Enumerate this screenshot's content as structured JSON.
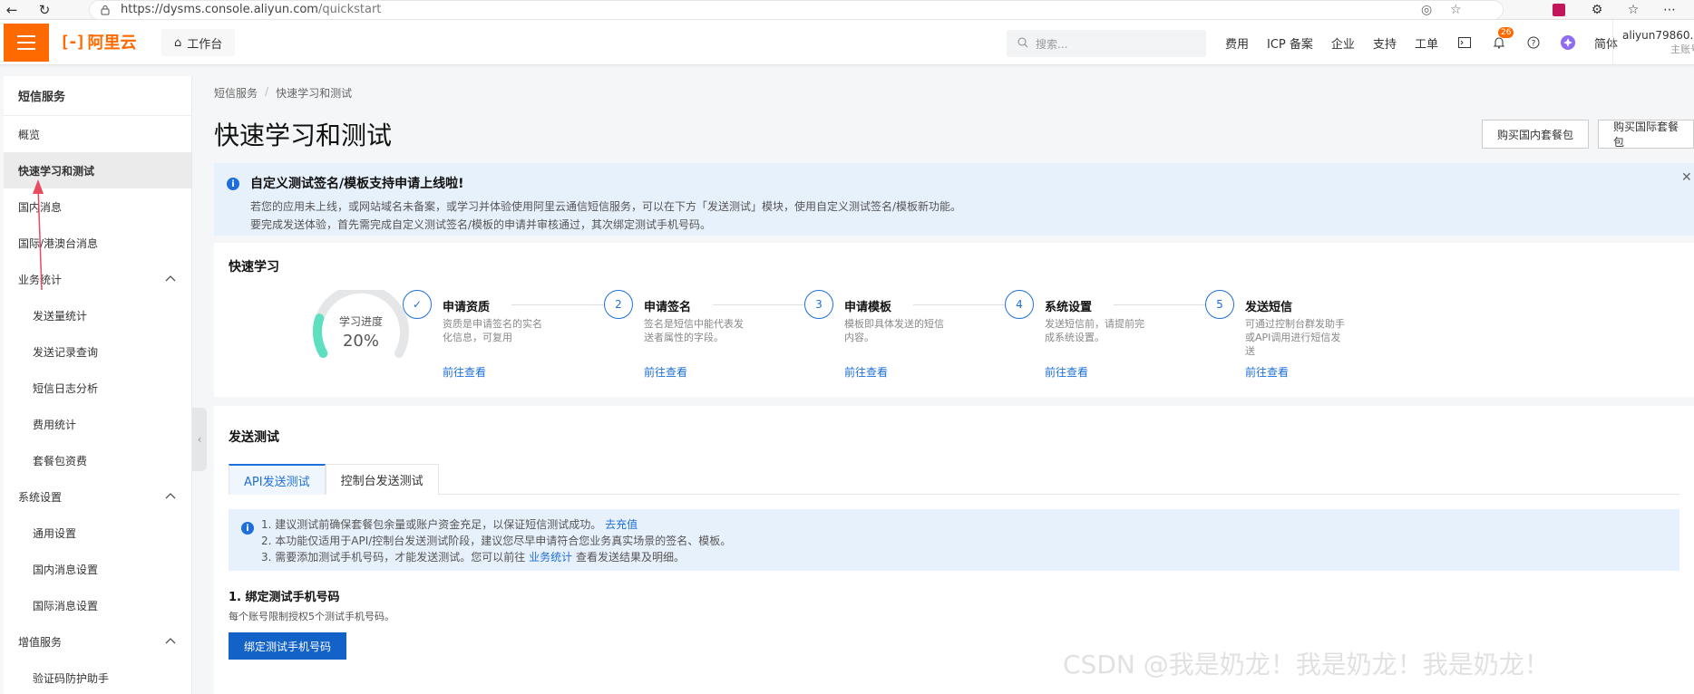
{
  "browser": {
    "url_host": "https://dysms.console.aliyun.com",
    "url_path": "/quickstart"
  },
  "topnav": {
    "logo_text": "阿里云",
    "workbench": "工作台",
    "search_placeholder": "搜索...",
    "links": [
      "费用",
      "ICP 备案",
      "企业",
      "支持",
      "工单"
    ],
    "notification_count": "26",
    "lang": "简体",
    "user_name": "aliyun79860...",
    "user_sub": "主账号"
  },
  "sidebar": {
    "title": "短信服务",
    "items": [
      {
        "label": "概览",
        "level": 1
      },
      {
        "label": "快速学习和测试",
        "level": 1,
        "active": true
      },
      {
        "label": "国内消息",
        "level": 1
      },
      {
        "label": "国际/港澳台消息",
        "level": 1
      },
      {
        "label": "业务统计",
        "level": 1,
        "group": true
      },
      {
        "label": "发送量统计",
        "level": 2
      },
      {
        "label": "发送记录查询",
        "level": 2
      },
      {
        "label": "短信日志分析",
        "level": 2
      },
      {
        "label": "费用统计",
        "level": 2
      },
      {
        "label": "套餐包资费",
        "level": 2
      },
      {
        "label": "系统设置",
        "level": 1,
        "group": true
      },
      {
        "label": "通用设置",
        "level": 2
      },
      {
        "label": "国内消息设置",
        "level": 2
      },
      {
        "label": "国际消息设置",
        "level": 2
      },
      {
        "label": "增值服务",
        "level": 1,
        "group": true
      },
      {
        "label": "验证码防护助手",
        "level": 2
      }
    ]
  },
  "breadcrumb": [
    "短信服务",
    "快速学习和测试"
  ],
  "page_title": "快速学习和测试",
  "actions": {
    "buy_domestic": "购买国内套餐包",
    "buy_international": "购买国际套餐包"
  },
  "notice": {
    "head": "自定义测试签名/模板支持申请上线啦!",
    "line1": "若您的应用未上线，或网站域名未备案，或学习并体验使用阿里云通信短信服务，可以在下方「发送测试」模块，使用自定义测试签名/模板新功能。",
    "line2": "要完成发送体验，首先需完成自定义测试签名/模板的申请并审核通过，其次绑定测试手机号码。"
  },
  "learn": {
    "title": "快速学习",
    "progress_label": "学习进度",
    "progress_pct": "20%",
    "progress_value": 0.2,
    "steps": [
      {
        "num": "✓",
        "title": "申请资质",
        "desc": "资质是申请签名的实名化信息，可复用",
        "link": "前往查看",
        "done": true
      },
      {
        "num": "2",
        "title": "申请签名",
        "desc": "签名是短信中能代表发送者属性的字段。",
        "link": "前往查看"
      },
      {
        "num": "3",
        "title": "申请模板",
        "desc": "模板即具体发送的短信内容。",
        "link": "前往查看"
      },
      {
        "num": "4",
        "title": "系统设置",
        "desc": "发送短信前，请提前完成系统设置。",
        "link": "前往查看"
      },
      {
        "num": "5",
        "title": "发送短信",
        "desc": "可通过控制台群发助手或API调用进行短信发送",
        "link": "前往查看"
      }
    ]
  },
  "send_test": {
    "title": "发送测试",
    "tabs": [
      "API发送测试",
      "控制台发送测试"
    ],
    "tip1": "1. 建议测试前确保套餐包余量或账户资金充足，以保证短信测试成功。",
    "tip1_link": "去充值",
    "tip2": "2. 本功能仅适用于API/控制台发送测试阶段，建议您尽早申请符合您业务真实场景的签名、模板。",
    "tip3_a": "3. 需要添加测试手机号码，才能发送测试。您可以前往",
    "tip3_link": "业务统计",
    "tip3_b": "查看发送结果及明细。",
    "section_title": "1. 绑定测试手机号码",
    "section_desc": "每个账号限制授权5个测试手机号码。",
    "bind_button": "绑定测试手机号码"
  },
  "watermark": "CSDN @我是奶龙！我是奶龙！我是奶龙！",
  "colors": {
    "brand": "#ff6a00",
    "primary": "#1e6fd9",
    "gauge": "#5ee0c0"
  }
}
